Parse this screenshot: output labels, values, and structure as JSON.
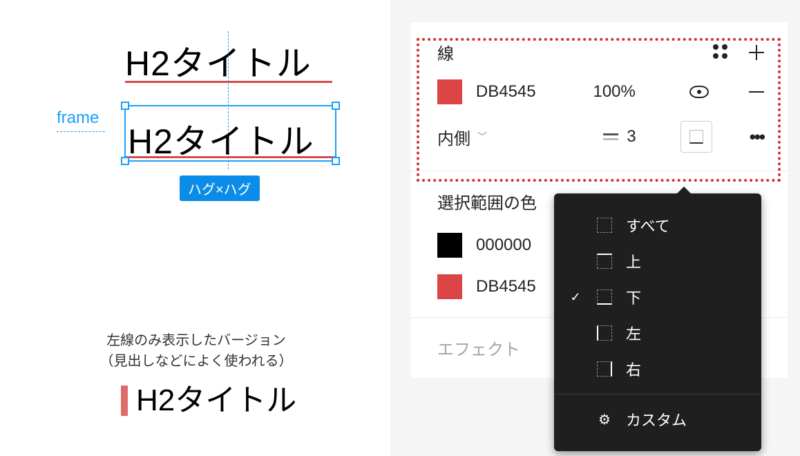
{
  "canvas": {
    "title1": "H2タイトル",
    "title2": "H2タイトル",
    "frame_label": "frame",
    "hug_badge": "ハグ×ハグ",
    "note_line1": "左線のみ表示したバージョン",
    "note_line2": "（見出しなどによく使われる）",
    "title3": "H2タイトル"
  },
  "stroke": {
    "section_title": "線",
    "color_hex": "DB4545",
    "opacity": "100%",
    "position": "内側",
    "weight": "3"
  },
  "selection_colors": {
    "section_title": "選択範囲の色",
    "colors": [
      "000000",
      "DB4545"
    ]
  },
  "effects": {
    "section_title": "エフェクト"
  },
  "side_menu": {
    "all": "すべて",
    "top": "上",
    "bottom": "下",
    "left": "左",
    "right": "右",
    "custom": "カスタム"
  }
}
